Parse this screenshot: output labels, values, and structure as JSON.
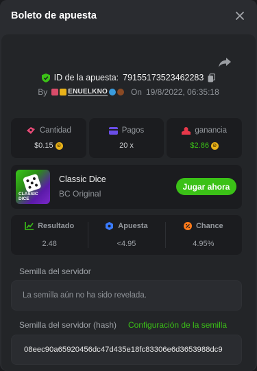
{
  "header": {
    "title": "Boleto de apuesta"
  },
  "bet": {
    "id_label": "ID de la apuesta:",
    "id_value": "79155173523462283",
    "by_label": "By",
    "username": "ENUELKNO",
    "on_label": "On",
    "datetime": "19/8/2022, 06:35:18"
  },
  "stats": [
    {
      "label": "Cantidad",
      "value": "$0.15",
      "icon": "money-icon",
      "color": "#e64a76"
    },
    {
      "label": "Pagos",
      "value": "20 x",
      "icon": "payout-icon",
      "color": "#6a4ee8"
    },
    {
      "label": "ganancia",
      "value": "$2.86",
      "icon": "profit-icon",
      "color": "#e8384a"
    }
  ],
  "game": {
    "name": "Classic Dice",
    "provider": "BC Original",
    "thumb_text": "CLASSIC DICE",
    "play_label": "Jugar ahora"
  },
  "results": [
    {
      "label": "Resultado",
      "value": "2.48",
      "icon": "chart-icon",
      "color": "#3bc117"
    },
    {
      "label": "Apuesta",
      "value": "<4.95",
      "icon": "target-icon",
      "color": "#3a7bff"
    },
    {
      "label": "Chance",
      "value": "4.95%",
      "icon": "percent-icon",
      "color": "#ff7a1a"
    }
  ],
  "server_seed": {
    "label": "Semilla del servidor",
    "value": "La semilla aún no ha sido revelada."
  },
  "server_seed_hash": {
    "label": "Semilla del servidor (hash)",
    "link": "Configuración de la semilla",
    "value": "08eec90a65920456dc47d435e18fc83306e6d3653988dc9"
  },
  "colors": {
    "accent_green": "#3bc117",
    "coin": "#e9b21a"
  }
}
